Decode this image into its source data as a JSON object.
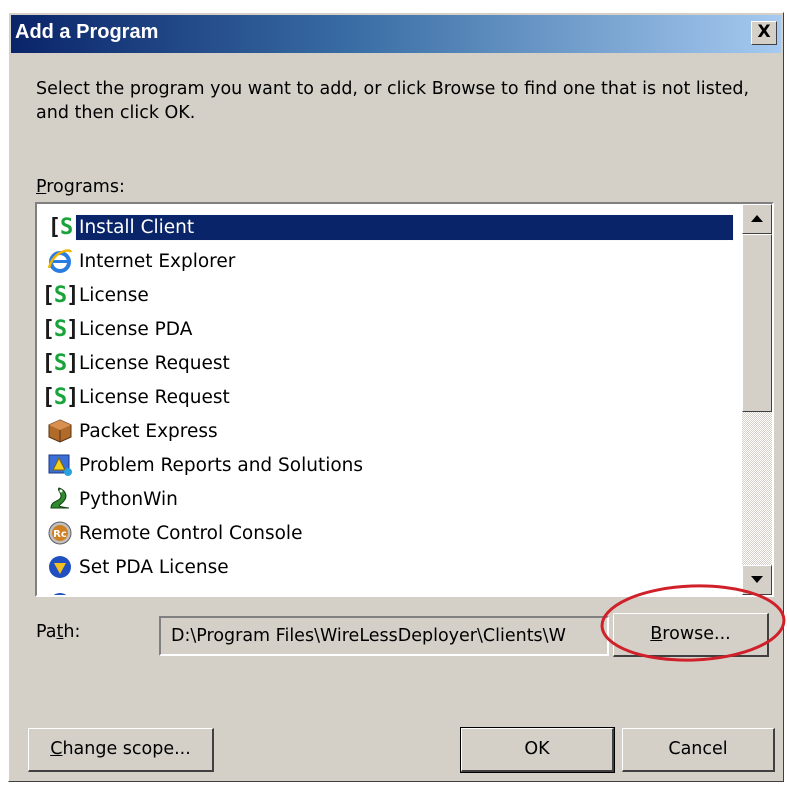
{
  "window": {
    "title": "Add a Program",
    "close_label": "X"
  },
  "description": "Select the program you want to add, or click Browse to find one that is not listed, and then click OK.",
  "programs": {
    "label_mnemonic": "P",
    "label_rest": "rograms:",
    "items": [
      {
        "label": "Install Client",
        "icon": "s-bracket-icon",
        "selected": true
      },
      {
        "label": "Internet Explorer",
        "icon": "internet-explorer-icon"
      },
      {
        "label": "License",
        "icon": "s-bracket-icon"
      },
      {
        "label": "License PDA",
        "icon": "s-bracket-icon"
      },
      {
        "label": "License Request",
        "icon": "s-bracket-icon"
      },
      {
        "label": "License Request",
        "icon": "s-bracket-icon"
      },
      {
        "label": "Packet Express",
        "icon": "package-icon"
      },
      {
        "label": "Problem Reports and Solutions",
        "icon": "problem-reports-icon"
      },
      {
        "label": "PythonWin",
        "icon": "python-icon"
      },
      {
        "label": "Remote Control Console",
        "icon": "rc-icon"
      },
      {
        "label": "Set PDA License",
        "icon": "shield-icon"
      }
    ]
  },
  "path": {
    "label_pre": "Pa",
    "label_mnemonic": "t",
    "label_post": "h:",
    "value": "D:\\Program Files\\WireLessDeployer\\Clients\\W"
  },
  "buttons": {
    "browse_mnemonic": "B",
    "browse_rest": "rowse...",
    "change_scope_mnemonic": "C",
    "change_scope_rest": "hange scope...",
    "ok": "OK",
    "cancel": "Cancel"
  },
  "colors": {
    "title_gradient_start": "#0a246a",
    "title_gradient_end": "#a6caf0",
    "selection": "#0a246a",
    "annotation_circle": "#d0202a",
    "dialog_face": "#d4d0c8"
  }
}
